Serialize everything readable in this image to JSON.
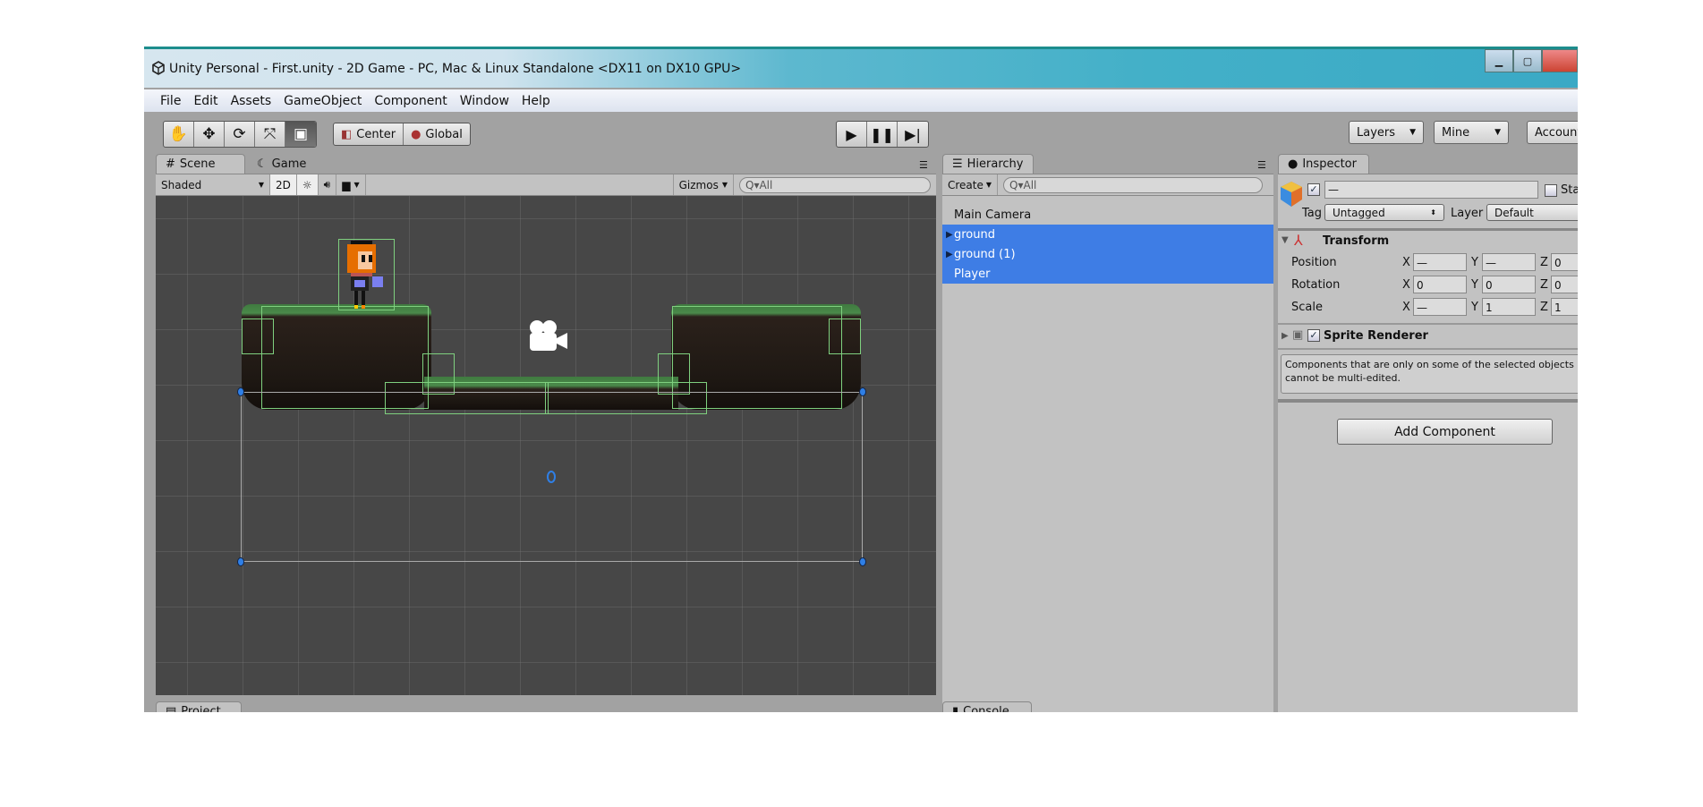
{
  "window": {
    "title": "Unity Personal - First.unity - 2D Game - PC, Mac & Linux Standalone <DX11 on DX10 GPU>"
  },
  "menu": [
    "File",
    "Edit",
    "Assets",
    "GameObject",
    "Component",
    "Window",
    "Help"
  ],
  "toolbar": {
    "tools": [
      {
        "icon": "hand-icon",
        "glyph": "✋"
      },
      {
        "icon": "move-icon",
        "glyph": "✥"
      },
      {
        "icon": "rotate-icon",
        "glyph": "⟳"
      },
      {
        "icon": "scale-icon",
        "glyph": "⤧"
      },
      {
        "icon": "rect-tool-icon",
        "glyph": "▣"
      }
    ],
    "pivot": "Center",
    "space": "Global",
    "layers": "Layers",
    "layout": "Mine",
    "account": "Account"
  },
  "scene_panel": {
    "tabs": [
      "Scene",
      "Game"
    ],
    "shading": "Shaded",
    "mode_2d": "2D",
    "gizmos": "Gizmos",
    "search_placeholder": "All"
  },
  "hierarchy": {
    "tab": "Hierarchy",
    "create": "Create",
    "search_placeholder": "All",
    "items": [
      {
        "label": "Main Camera",
        "selected": false,
        "expandable": false
      },
      {
        "label": "ground",
        "selected": true,
        "expandable": true
      },
      {
        "label": "ground (1)",
        "selected": true,
        "expandable": true
      },
      {
        "label": "Player",
        "selected": true,
        "expandable": false
      }
    ]
  },
  "inspector": {
    "tab": "Inspector",
    "name_value": "—",
    "static_label": "Static",
    "tag_label": "Tag",
    "tag_value": "Untagged",
    "layer_label": "Layer",
    "layer_value": "Default",
    "transform": {
      "title": "Transform",
      "rows": [
        {
          "label": "Position",
          "x": "—",
          "y": "—",
          "z": "0"
        },
        {
          "label": "Rotation",
          "x": "0",
          "y": "0",
          "z": "0"
        },
        {
          "label": "Scale",
          "x": "—",
          "y": "1",
          "z": "1"
        }
      ]
    },
    "sprite_renderer": "Sprite Renderer",
    "note": "Components that are only on some of the selected objects cannot be multi-edited.",
    "add_component": "Add Component"
  },
  "bottom_tabs": [
    "Project",
    "Console"
  ],
  "colors": {
    "selection": "#3e7de5",
    "scene_bg": "#474747",
    "collider": "#7fd07f",
    "handle": "#2f7fe6"
  }
}
